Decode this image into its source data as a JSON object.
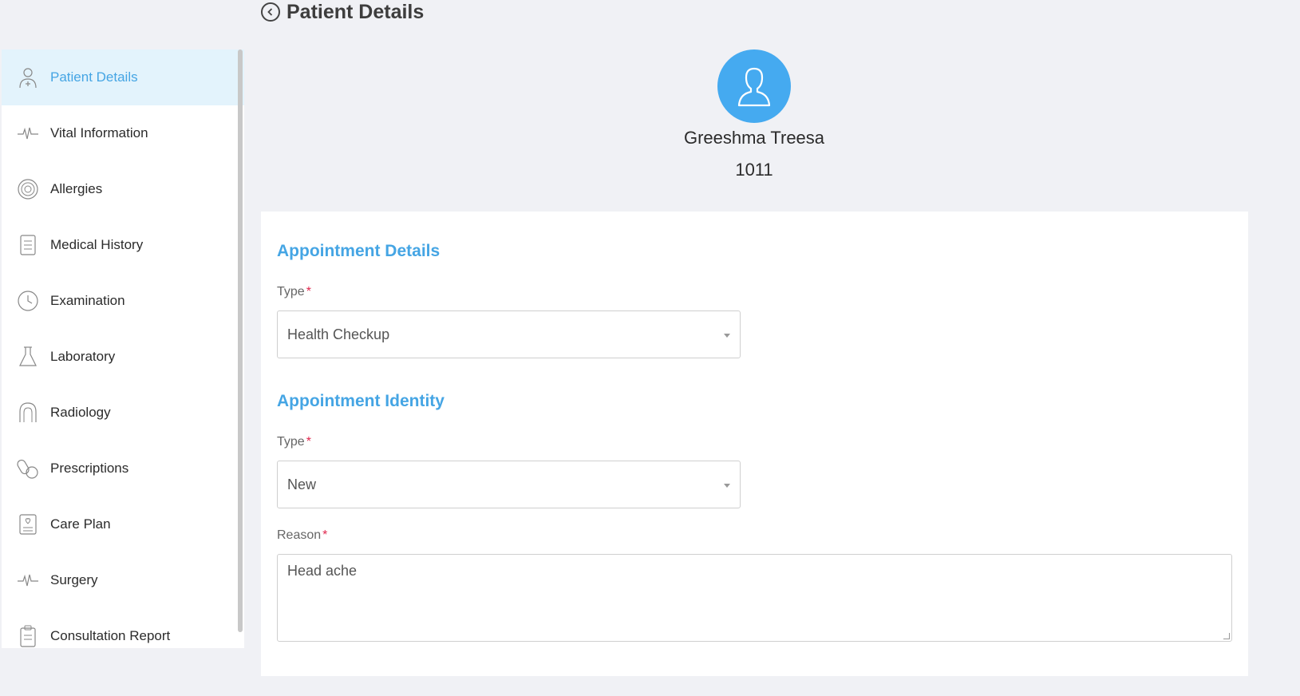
{
  "header": {
    "title": "Patient Details"
  },
  "sidebar": {
    "items": [
      {
        "label": "Patient Details",
        "icon": "doctor-icon",
        "active": true
      },
      {
        "label": "Vital Information",
        "icon": "pulse-icon"
      },
      {
        "label": "Allergies",
        "icon": "fingerprint-icon"
      },
      {
        "label": "Medical History",
        "icon": "report-icon"
      },
      {
        "label": "Examination",
        "icon": "clock-history-icon"
      },
      {
        "label": "Laboratory",
        "icon": "flask-icon"
      },
      {
        "label": "Radiology",
        "icon": "scanner-icon"
      },
      {
        "label": "Prescriptions",
        "icon": "pills-icon"
      },
      {
        "label": "Care Plan",
        "icon": "care-plan-icon"
      },
      {
        "label": "Surgery",
        "icon": "pulse-icon"
      },
      {
        "label": "Consultation Report",
        "icon": "clipboard-icon"
      }
    ]
  },
  "patient": {
    "name": "Greeshma Treesa",
    "id": "1011"
  },
  "appointment_details": {
    "title": "Appointment Details",
    "type_label": "Type",
    "type_value": "Health Checkup"
  },
  "appointment_identity": {
    "title": "Appointment Identity",
    "type_label": "Type",
    "type_value": "New",
    "reason_label": "Reason",
    "reason_value": "Head ache"
  },
  "required_mark": "*",
  "colors": {
    "accent": "#45a5e4",
    "avatar": "#45aaf0",
    "required": "#e0284e"
  }
}
